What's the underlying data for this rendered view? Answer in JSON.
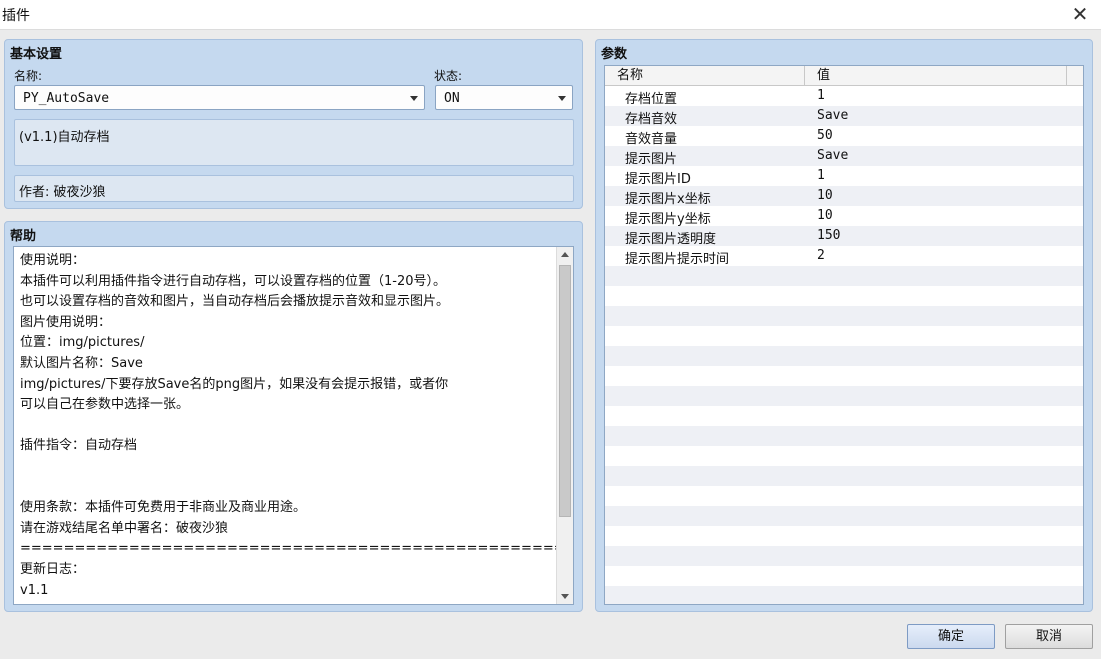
{
  "window": {
    "title": "插件",
    "close_icon": "close-icon"
  },
  "basic": {
    "title": "基本设置",
    "name_label": "名称:",
    "name_value": "PY_AutoSave",
    "status_label": "状态:",
    "status_value": "ON",
    "description": "(v1.1)自动存档",
    "author": "作者: 破夜沙狼"
  },
  "help": {
    "title": "帮助",
    "lines": [
      "使用说明：",
      "本插件可以利用插件指令进行自动存档，可以设置存档的位置（1-20号）。",
      "也可以设置存档的音效和图片，当自动存档后会播放提示音效和显示图片。",
      "图片使用说明：",
      "位置：img/pictures/",
      "默认图片名称：Save",
      "img/pictures/下要存放Save名的png图片，如果没有会提示报错，或者你",
      "可以自己在参数中选择一张。",
      "",
      "插件指令：自动存档",
      "",
      "",
      "使用条款：本插件可免费用于非商业及商业用途。",
      "请在游戏结尾名单中署名：破夜沙狼",
      "==========================================================================",
      "更新日志：",
      "v1.1"
    ]
  },
  "params": {
    "title": "参数",
    "col_name": "名称",
    "col_value": "值",
    "rows": [
      {
        "name": "存档位置",
        "value": "1"
      },
      {
        "name": "存档音效",
        "value": "Save"
      },
      {
        "name": "音效音量",
        "value": "50"
      },
      {
        "name": "提示图片",
        "value": "Save"
      },
      {
        "name": "提示图片ID",
        "value": "1"
      },
      {
        "name": "提示图片x坐标",
        "value": "10"
      },
      {
        "name": "提示图片y坐标",
        "value": "10"
      },
      {
        "name": "提示图片透明度",
        "value": "150"
      },
      {
        "name": "提示图片提示时间",
        "value": "2"
      }
    ]
  },
  "buttons": {
    "ok": "确定",
    "cancel": "取消"
  }
}
